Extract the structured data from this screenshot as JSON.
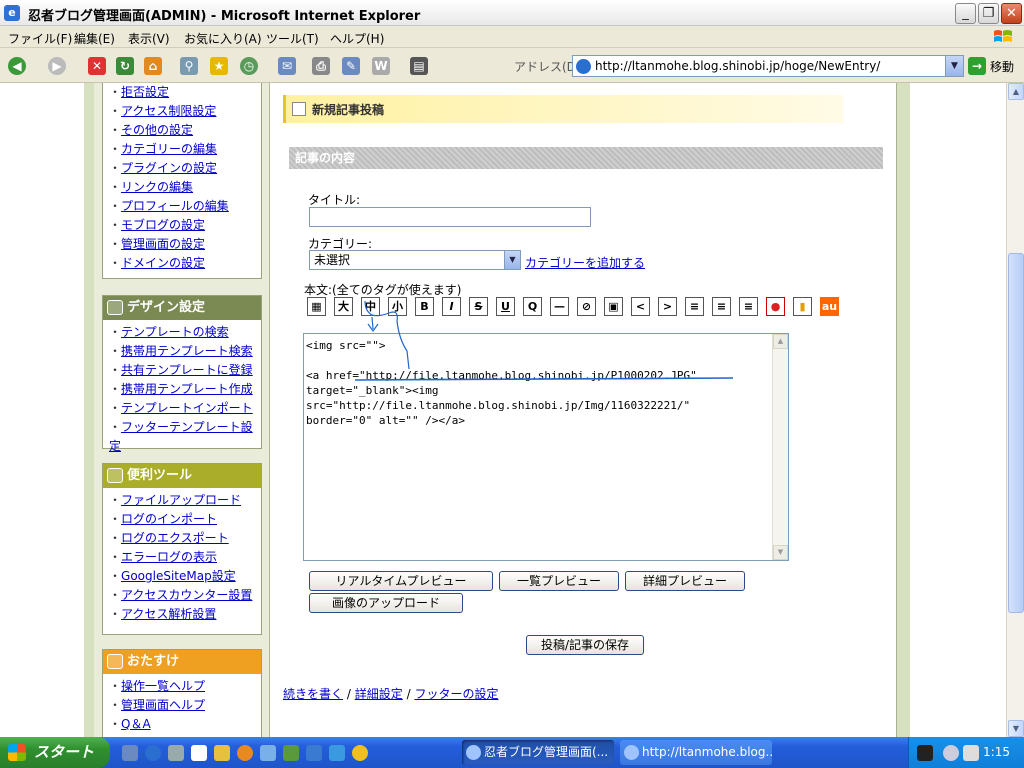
{
  "window": {
    "title": "忍者ブログ管理画面(ADMIN) - Microsoft Internet Explorer",
    "minimize": "_",
    "maximize": "❐",
    "close": "✕"
  },
  "menu": [
    "ファイル(F)",
    "編集(E)",
    "表示(V)",
    "お気に入り(A)",
    "ツール(T)",
    "ヘルプ(H)"
  ],
  "address": {
    "label": "アドレス(D)",
    "url": "http://ltanmohe.blog.shinobi.jp/hoge/NewEntry/",
    "go_label": "移動"
  },
  "sidebar": {
    "top_links": [
      "拒否設定",
      "アクセス制限設定",
      "その他の設定",
      "カテゴリーの編集",
      "プラグインの設定",
      "リンクの編集",
      "プロフィールの編集",
      "モブログの設定",
      "管理画面の設定",
      "ドメインの設定"
    ],
    "design": {
      "title": "デザイン設定",
      "color": "#7a8a52",
      "links": [
        "テンプレートの検索",
        "携帯用テンプレート検索",
        "共有テンプレートに登録",
        "携帯用テンプレート作成",
        "テンプレートインポート",
        "フッターテンプレート設定"
      ]
    },
    "tools": {
      "title": "便利ツール",
      "color": "#a9ad2a",
      "links": [
        "ファイルアップロード",
        "ログのインポート",
        "ログのエクスポート",
        "エラーログの表示",
        "GoogleSiteMap設定",
        "アクセスカウンター設置",
        "アクセス解析設置"
      ]
    },
    "recommend": {
      "title": "おたすけ",
      "color": "#f0a020",
      "links": [
        "操作一覧ヘルプ",
        "管理画面ヘルプ",
        "Q＆A"
      ]
    }
  },
  "main": {
    "title": "新規記事投稿",
    "section": "記事の内容",
    "title_label": "タイトル:",
    "title_value": "",
    "category_label": "カテゴリー:",
    "category_value": "未選択",
    "add_category": "カテゴリーを追加する",
    "body_label": "本文:(全てのタグが使えます)",
    "format_buttons": [
      {
        "name": "color-picker",
        "label": "▦",
        "color": "#000000"
      },
      {
        "name": "large",
        "label": "大",
        "color": "#000000"
      },
      {
        "name": "medium",
        "label": "中",
        "color": "#000000"
      },
      {
        "name": "small",
        "label": "小",
        "color": "#000000"
      },
      {
        "name": "bold",
        "label": "B",
        "color": "#000000"
      },
      {
        "name": "italic",
        "label": "I",
        "color": "#000000"
      },
      {
        "name": "strike",
        "label": "S",
        "color": "#000000"
      },
      {
        "name": "underline",
        "label": "U",
        "color": "#000000"
      },
      {
        "name": "quote",
        "label": "Q",
        "color": "#000000"
      },
      {
        "name": "hr",
        "label": "—",
        "color": "#000000"
      },
      {
        "name": "link",
        "label": "⊘",
        "color": "#000000"
      },
      {
        "name": "image",
        "label": "▣",
        "color": "#000000"
      },
      {
        "name": "less-than",
        "label": "<",
        "color": "#000000"
      },
      {
        "name": "greater-than",
        "label": ">",
        "color": "#000000"
      },
      {
        "name": "align-left",
        "label": "≡",
        "color": "#000000"
      },
      {
        "name": "align-right",
        "label": "≡",
        "color": "#000000"
      },
      {
        "name": "align-center",
        "label": "≡",
        "color": "#000000"
      },
      {
        "name": "emoji-docomo",
        "label": "●",
        "color": "#e02020"
      },
      {
        "name": "emoji-softbank",
        "label": "▮",
        "color": "#e0a000"
      },
      {
        "name": "emoji-au",
        "label": "au",
        "color": "#ff6600"
      }
    ],
    "body_text": "<img src=\"\">\n\n<a href=\"http://file.ltanmohe.blog.shinobi.jp/P1000202.JPG\"\ntarget=\"_blank\"><img\nsrc=\"http://file.ltanmohe.blog.shinobi.jp/Img/1160322221/\"\nborder=\"0\" alt=\"\" /></a>",
    "buttons": {
      "realtime_preview": "リアルタイムプレビュー",
      "list_preview": "一覧プレビュー",
      "detail_preview": "詳細プレビュー",
      "upload_image": "画像のアップロード",
      "save": "投稿/記事の保存"
    },
    "footer_links": [
      "続きを書く",
      "詳細設定",
      "フッターの設定"
    ],
    "footer_sep": "/"
  },
  "taskbar": {
    "start": "スタート",
    "tasks": [
      "忍者ブログ管理画面(...",
      "http://ltanmohe.blog..."
    ],
    "clock": "1:15"
  }
}
